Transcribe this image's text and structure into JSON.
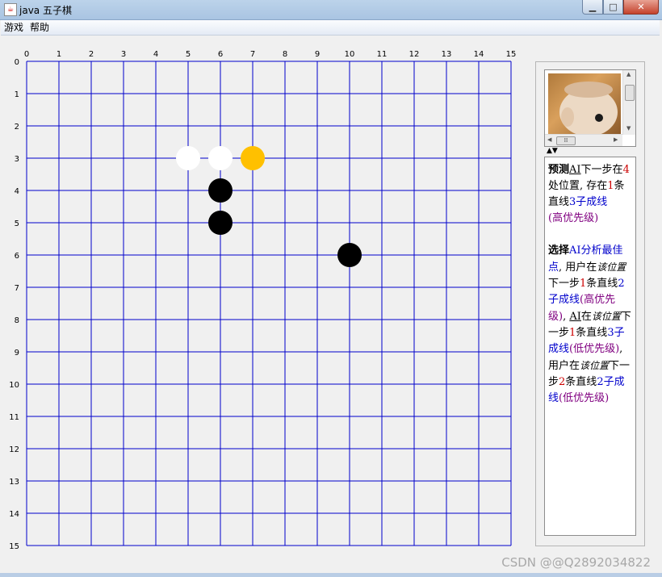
{
  "window": {
    "title": "java 五子棋"
  },
  "menu": [
    {
      "label": "游戏"
    },
    {
      "label": "帮助"
    }
  ],
  "board": {
    "size": 15,
    "x_labels": [
      "0",
      "1",
      "2",
      "3",
      "4",
      "5",
      "6",
      "7",
      "8",
      "9",
      "10",
      "11",
      "12",
      "13",
      "14",
      "15"
    ],
    "y_labels": [
      "0",
      "1",
      "2",
      "3",
      "4",
      "5",
      "6",
      "7",
      "8",
      "9",
      "10",
      "11",
      "12",
      "13",
      "14",
      "15"
    ],
    "line_color": "#0000cc",
    "stones": [
      {
        "x": 5,
        "y": 3,
        "color": "white"
      },
      {
        "x": 6,
        "y": 3,
        "color": "white"
      },
      {
        "x": 7,
        "y": 3,
        "color": "orange"
      },
      {
        "x": 6,
        "y": 4,
        "color": "black"
      },
      {
        "x": 6,
        "y": 5,
        "color": "black"
      },
      {
        "x": 10,
        "y": 6,
        "color": "black"
      }
    ]
  },
  "colors": {
    "white": "#ffffff",
    "black": "#000000",
    "orange": "#ffc000"
  },
  "info_panel": {
    "p1": {
      "a": "预测",
      "b": "AI",
      "c": "下一步在",
      "d": "4",
      "e": "处位置, 存在",
      "f": "1",
      "g": "条直线",
      "h": "3",
      "i": "子成线",
      "j": "(高优先级)"
    },
    "p2": {
      "a": "选择",
      "b": "AI分析最佳点",
      "c": ", 用户在",
      "d": "该位置",
      "e": "下一步",
      "f": "1",
      "g": "条直线",
      "h": "2",
      "i": "子成线",
      "j": "(高优先级)",
      "k": ", ",
      "l": "AI",
      "m": "在",
      "n": "该位置",
      "o": "下一步",
      "p": "1",
      "q": "条直线",
      "r": "3",
      "s": "子成线",
      "t": "(低优先级)",
      "u": ", 用户在",
      "v": "该位置",
      "w": "下一步",
      "x": "2",
      "y": "条直线",
      "z": "2",
      "aa": "子成线",
      "ab": "(低优先级)"
    }
  },
  "watermark": "CSDN @@Q2892034822"
}
